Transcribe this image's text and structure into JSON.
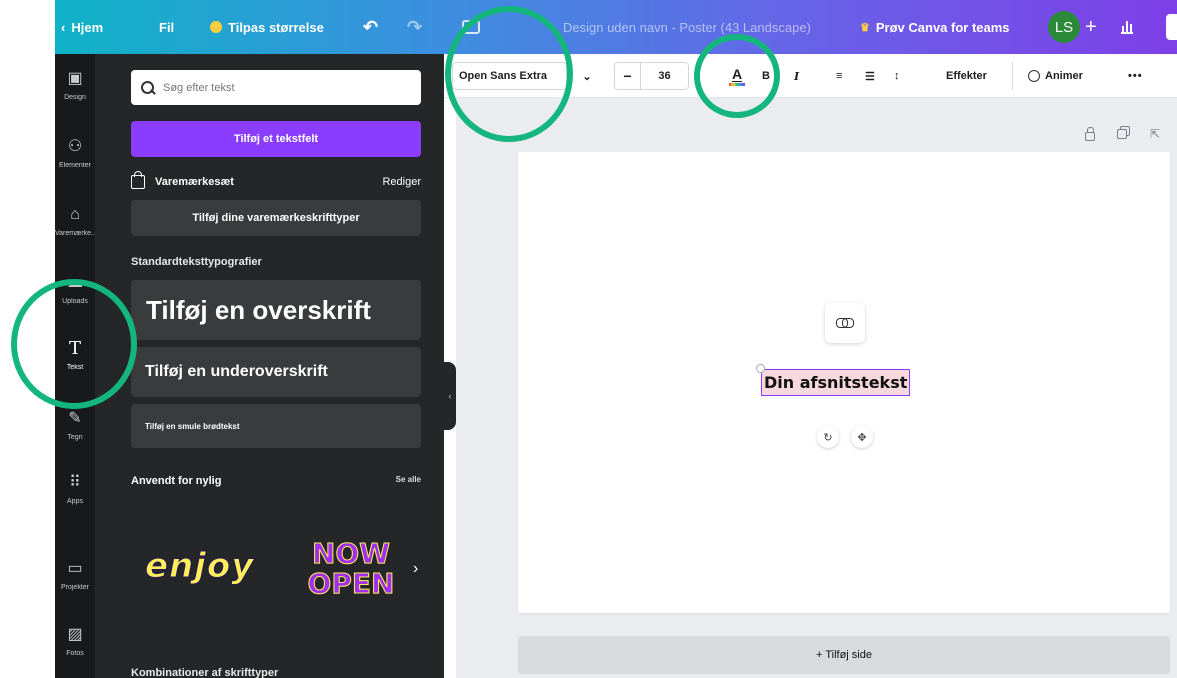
{
  "topbar": {
    "home": "Hjem",
    "file": "Fil",
    "resize": "Tilpas størrelse",
    "undo_icon": "undo-icon",
    "redo_icon": "redo-icon",
    "doc_title": "Design uden navn - Poster (43 Landscape)",
    "teams": "Prøv Canva for teams",
    "avatar": "LS",
    "plus": "+",
    "gradient_start": "#0fb3c7",
    "gradient_end": "#7d3fe8"
  },
  "rail": {
    "items": [
      {
        "label": "Design",
        "icon": "design-icon"
      },
      {
        "label": "Elementer",
        "icon": "elements-icon"
      },
      {
        "label": "Varemærke...",
        "icon": "brand-icon"
      },
      {
        "label": "Uploads",
        "icon": "upload-icon"
      },
      {
        "label": "Tekst",
        "icon": "text-icon"
      },
      {
        "label": "Tegn",
        "icon": "draw-icon"
      },
      {
        "label": "Apps",
        "icon": "apps-icon"
      },
      {
        "label": "Projekter",
        "icon": "folder-icon"
      },
      {
        "label": "Fotos",
        "icon": "photo-icon"
      }
    ]
  },
  "panel": {
    "search_placeholder": "Søg efter tekst",
    "add_textbox": "Tilføj et tekstfelt",
    "brand_kit": "Varemærkesæt",
    "brand_edit": "Rediger",
    "add_brand_fonts": "Tilføj dine varemærkeskrifttyper",
    "default_typography": "Standardteksttypografier",
    "heading": "Tilføj en overskrift",
    "subheading": "Tilføj en underoverskrift",
    "body": "Tilføj en smule brødtekst",
    "recent": "Anvendt for nylig",
    "see_all": "Se alle",
    "recent_1": "enjoy",
    "recent_2": "NOW OPEN",
    "combinations": "Kombinationer af skrifttyper",
    "accent": "#8b3dff"
  },
  "toolbar": {
    "font": "Open Sans Extra",
    "minus": "−",
    "size": "36",
    "color_letter": "A",
    "bold": "B",
    "italic": "I",
    "effects": "Effekter",
    "animate": "Animer",
    "more": "•••"
  },
  "canvas": {
    "text": "Din afsnitstekst",
    "add_page": "+ Tilføj side"
  }
}
